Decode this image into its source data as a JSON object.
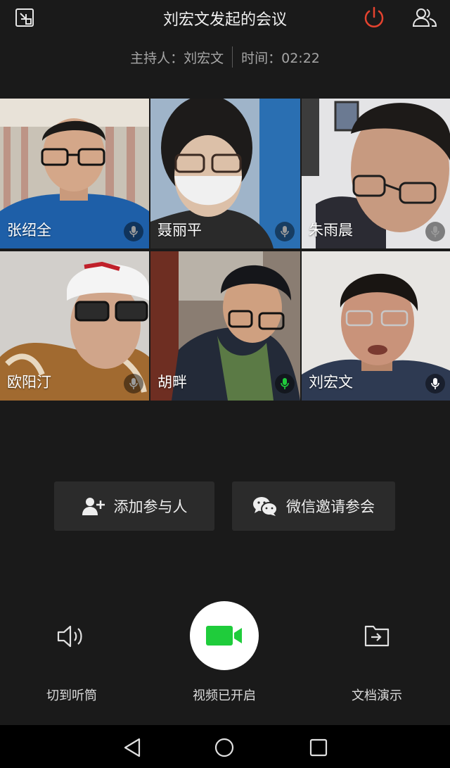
{
  "header": {
    "title": "刘宏文发起的会议",
    "host_label": "主持人：刘宏文",
    "time_label": "时间：02:22"
  },
  "participants": [
    {
      "name": "张绍全"
    },
    {
      "name": "聂丽平"
    },
    {
      "name": "朱雨晨"
    },
    {
      "name": "欧阳汀"
    },
    {
      "name": "胡畔"
    },
    {
      "name": "刘宏文"
    }
  ],
  "actions": {
    "add_participant": "添加参与人",
    "wechat_invite": "微信邀请参会"
  },
  "controls": {
    "earpiece": "切到听筒",
    "video": "视频已开启",
    "docs": "文档演示"
  },
  "colors": {
    "accent_green": "#1fcc3b",
    "power_red": "#e5432f",
    "background": "#1a1a1a"
  },
  "icons": [
    "minimize-window-icon",
    "power-icon",
    "members-icon",
    "add-person-icon",
    "wechat-icon",
    "speaker-icon",
    "video-camera-icon",
    "share-document-icon",
    "mic-icon",
    "back-icon",
    "home-icon",
    "recent-apps-icon"
  ]
}
